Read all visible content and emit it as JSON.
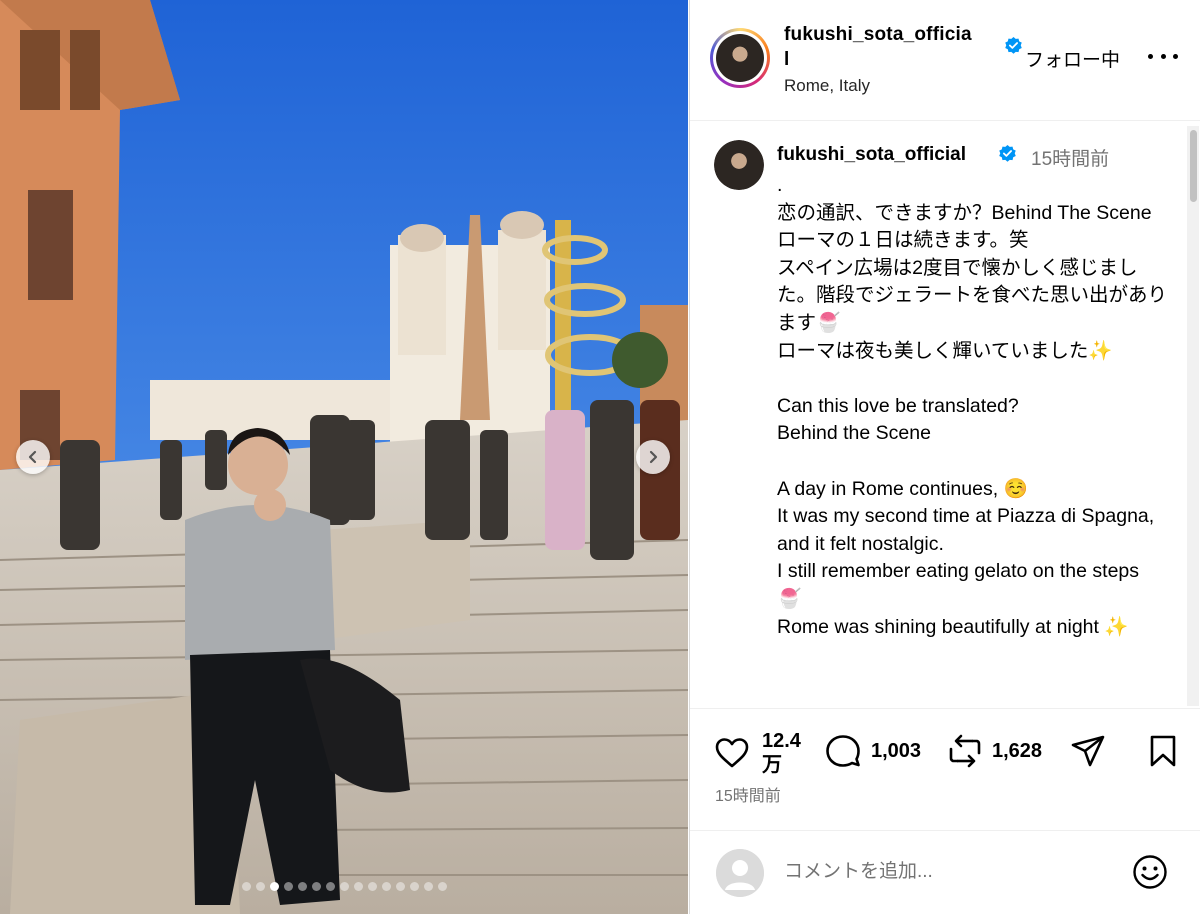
{
  "post": {
    "username": "fukushi_sota_official",
    "username_header_line1": "fukushi_sota_officia",
    "username_header_line2": "l",
    "location": "Rome, Italy",
    "follow_status": "フォロー中",
    "time_ago": "15時間前"
  },
  "caption": {
    "text": ".\n恋の通訳、できますか？Behind The Scene\nローマの１日は続きます。笑\nスペイン広場は2度目で懐かしく感じました。階段でジェラートを食べた思い出があります🍧\nローマは夜も美しく輝いていました✨\n\nCan this love be translated?\nBehind the Scene\n\nA day in Rome continues, ☺️\nIt was my second time at Piazza di Spagna, and it felt nostalgic.\nI still remember eating gelato on the steps 🍧\nRome was shining beautifully at night ✨"
  },
  "actions": {
    "likes": "12.4\n万",
    "comments": "1,003",
    "reposts": "1,628"
  },
  "comment_box": {
    "placeholder": "コメントを追加..."
  },
  "carousel": {
    "total": 15,
    "current": 3
  },
  "icons": {
    "verified": "verified-badge-icon",
    "like": "heart-icon",
    "comment": "comment-bubble-icon",
    "repost": "repost-icon",
    "share": "paper-plane-icon",
    "save": "bookmark-icon",
    "emoji": "smiley-icon",
    "more": "more-horizontal-icon"
  },
  "colors": {
    "verified_blue": "#0095f6",
    "secondary_text": "#737373",
    "sky": "#2f6fd0"
  }
}
